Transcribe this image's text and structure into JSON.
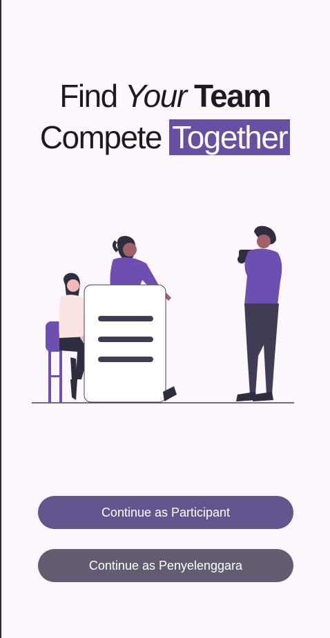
{
  "headline": {
    "line1": {
      "find": "Find",
      "your": "Your",
      "team": "Team"
    },
    "line2": {
      "compete": "Compete",
      "together": "Together"
    }
  },
  "colors": {
    "accent": "#6750a4",
    "background": "#fdf7fd",
    "primary_button": "#65558f",
    "secondary_button": "#625b71"
  },
  "illustration": {
    "name": "team-collaboration-illustration"
  },
  "buttons": {
    "participant": "Continue as Participant",
    "organizer": "Continue as Penyelenggara"
  }
}
